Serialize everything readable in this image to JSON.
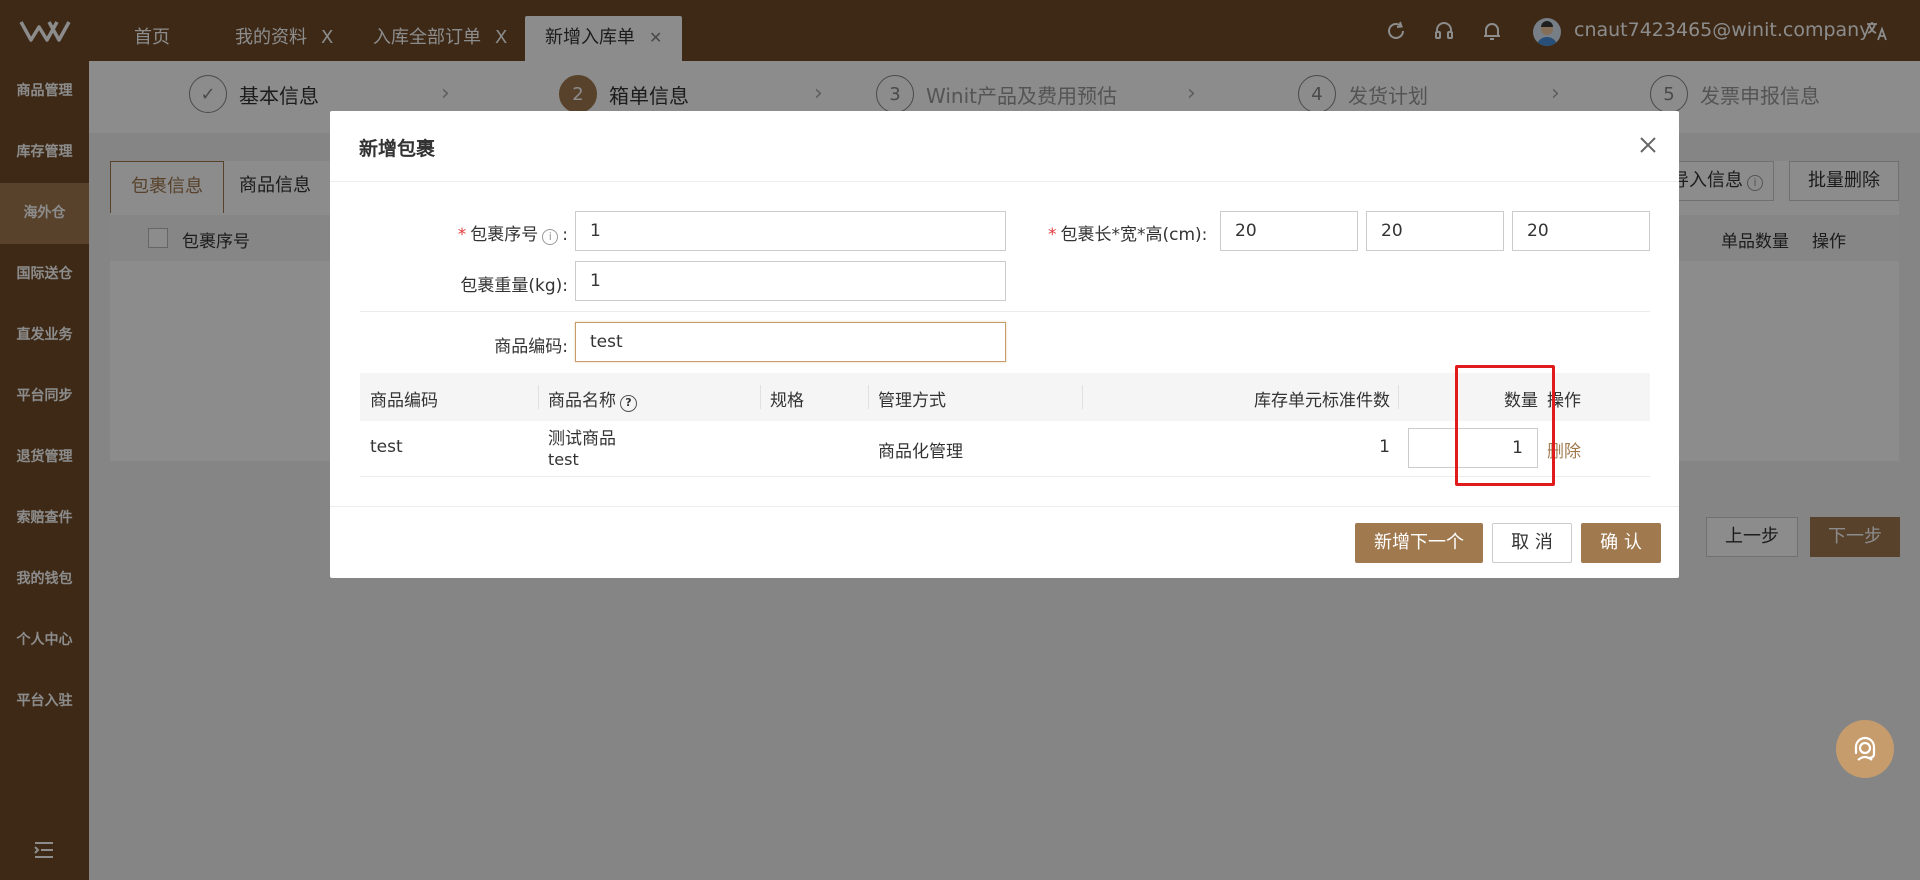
{
  "topbar": {
    "tabs": [
      {
        "label": "首页",
        "closable": false
      },
      {
        "label": "我的资料",
        "closable": true
      },
      {
        "label": "入库全部订单",
        "closable": true
      },
      {
        "label": "新增入库单",
        "closable": true,
        "active": true
      }
    ],
    "close_glyph": "X",
    "user_email": "cnaut7423465@winit.company",
    "icons": [
      "refresh-icon",
      "headset-icon",
      "bell-icon",
      "avatar",
      "translate-icon"
    ]
  },
  "sidenav": {
    "items": [
      "商品管理",
      "库存管理",
      "海外仓",
      "国际送仓",
      "直发业务",
      "平台同步",
      "退货管理",
      "索赔查件",
      "我的钱包",
      "个人中心",
      "平台入驻"
    ],
    "active_index": 2
  },
  "steps": [
    {
      "num": "✓",
      "label": "基本信息",
      "state": "done"
    },
    {
      "num": "2",
      "label": "箱单信息",
      "state": "current"
    },
    {
      "num": "3",
      "label": "Winit产品及费用预估",
      "state": "pending"
    },
    {
      "num": "4",
      "label": "发货计划",
      "state": "pending"
    },
    {
      "num": "5",
      "label": "发票申报信息",
      "state": "pending"
    }
  ],
  "background": {
    "tabs": [
      "包裹信息",
      "商品信息"
    ],
    "head_left": "包裹序号",
    "head_right": [
      "单品数量",
      "操作"
    ],
    "import_btn": "导入信息",
    "batch_delete": "批量删除",
    "prev_btn": "上一步",
    "next_btn": "下一步"
  },
  "modal": {
    "title": "新增包裹",
    "form": {
      "seq_label": "包裹序号",
      "seq_value": "1",
      "size_label": "包裹长*宽*高(cm)",
      "length": "20",
      "width": "20",
      "height": "20",
      "weight_label": "包裹重量(kg)",
      "weight_value": "1",
      "sku_label": "商品编码",
      "sku_value": "test",
      "colon": ":"
    },
    "table": {
      "headers": [
        "商品编码",
        "商品名称",
        "规格",
        "管理方式",
        "库存单元标准件数",
        "数量",
        "操作"
      ],
      "rows": [
        {
          "code": "test",
          "name": "测试商品",
          "name_sub": "test",
          "spec": "",
          "mode": "商品化管理",
          "unit_count": "1",
          "qty": "1",
          "action": "删除"
        }
      ]
    },
    "buttons": {
      "add_next": "新增下一个",
      "cancel": "取 消",
      "confirm": "确 认"
    }
  },
  "colors": {
    "brand": "#6f4c28",
    "accent": "#a0794f",
    "highlight": "#e01b1b"
  }
}
